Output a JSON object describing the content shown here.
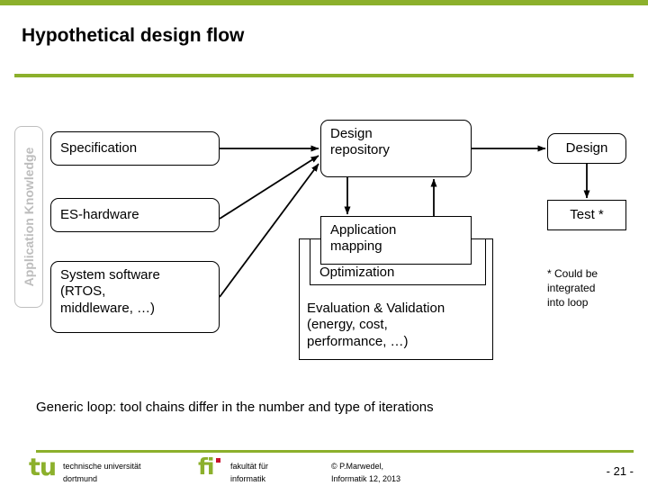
{
  "slide": {
    "title": "Hypothetical design flow",
    "accent_color": "#8CB02C",
    "side_label": "Application Knowledge",
    "caption": "Generic loop: tool chains differ in the number and type of iterations"
  },
  "diagram": {
    "inputs": [
      {
        "label": "Specification"
      },
      {
        "label": "ES-hardware"
      },
      {
        "label": "System software\n(RTOS,\nmiddleware, …)"
      }
    ],
    "repository": {
      "label": "Design\nrepository"
    },
    "loop": {
      "mapping": "Application\nmapping",
      "optimization": "Optimization",
      "evaluation": "Evaluation & Validation\n(energy, cost,\nperformance, …)"
    },
    "outputs": {
      "design": "Design",
      "test": "Test *",
      "footnote": "* Could be\nintegrated\ninto loop"
    }
  },
  "footer": {
    "tu_logo": "tu",
    "tu_line1": "technische universität",
    "tu_line2": "dortmund",
    "fi_logo": "fi",
    "fi_line1": "fakultät für",
    "fi_line2": "informatik",
    "copyright_line1": "© P.Marwedel,",
    "copyright_line2": "Informatik 12,  2013",
    "page_number": "- 21 -"
  }
}
